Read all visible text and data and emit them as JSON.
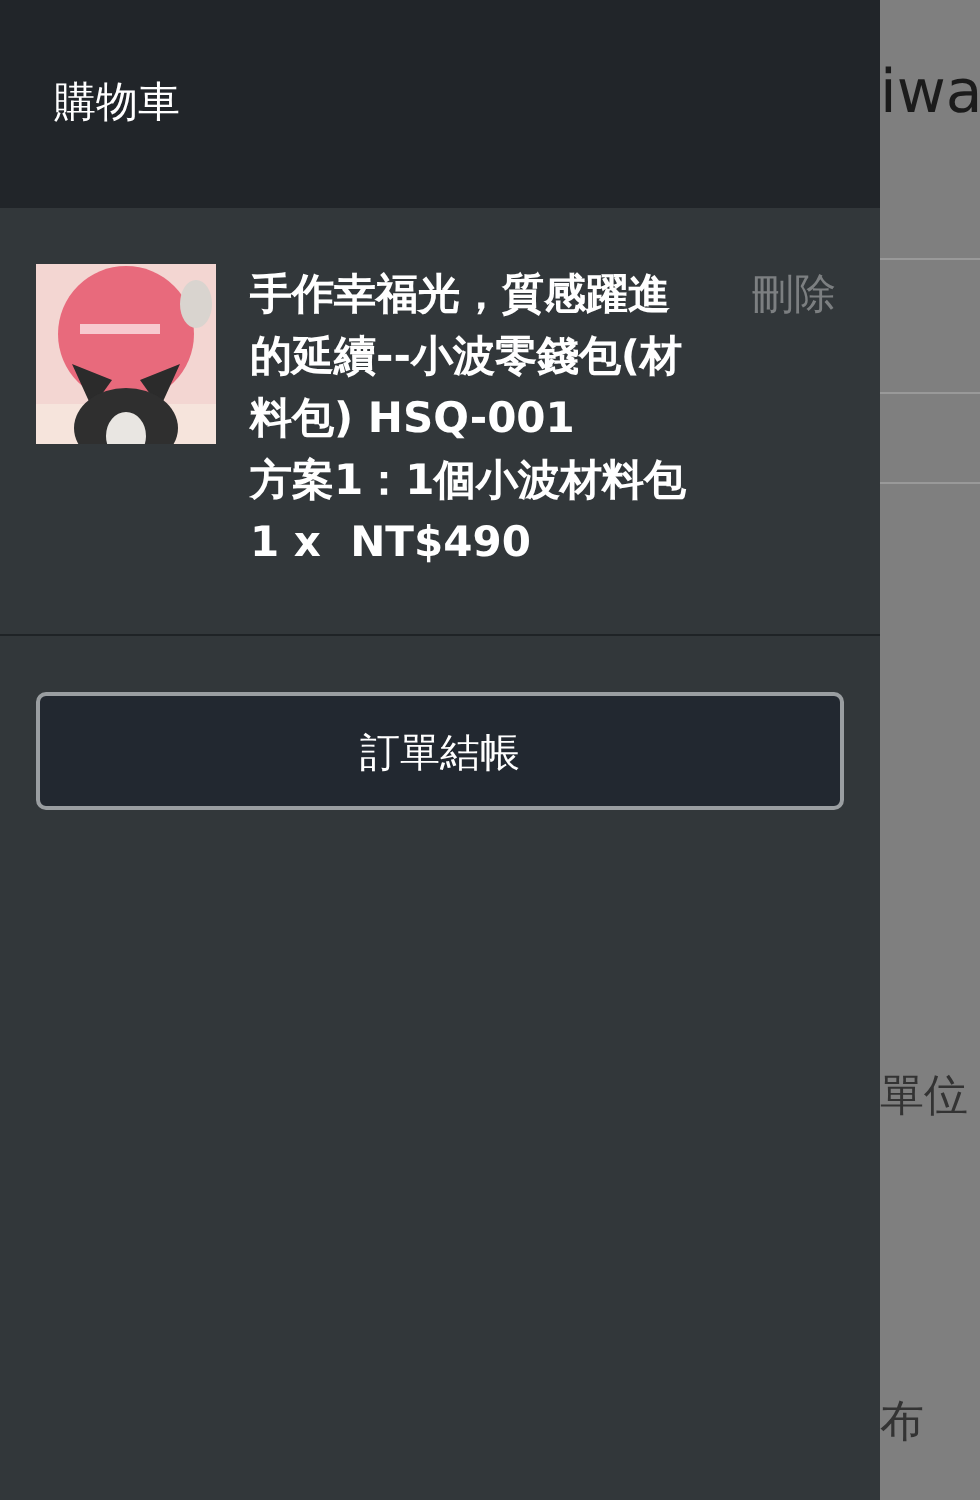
{
  "cart": {
    "title": "購物車",
    "items": [
      {
        "kind": "picture",
        "name": "手作幸福光，質感躍進的延續--小波零錢包(材料包) HSQ-001",
        "option": "方案1：1個小波材料包",
        "price": "1 x  NT$490",
        "remove": "刪除"
      }
    ],
    "checkout": "訂單結帳"
  },
  "background_page": {
    "heading": "iwa",
    "texts": [
      "單位",
      "布"
    ]
  }
}
